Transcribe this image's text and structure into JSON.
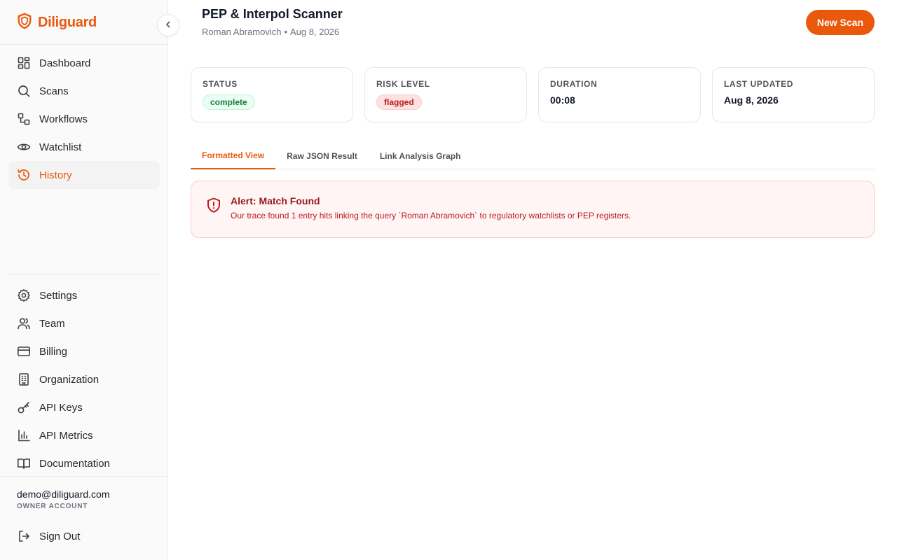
{
  "brand": {
    "name": "Diliguard",
    "accent": "#ea580c"
  },
  "nav": {
    "main": [
      {
        "label": "Dashboard",
        "icon": "dashboard-icon"
      },
      {
        "label": "Scans",
        "icon": "search-icon"
      },
      {
        "label": "Workflows",
        "icon": "workflow-icon"
      },
      {
        "label": "Watchlist",
        "icon": "eye-icon"
      },
      {
        "label": "History",
        "icon": "history-icon",
        "active": true
      }
    ],
    "bottom": [
      {
        "label": "Settings",
        "icon": "gear-icon"
      },
      {
        "label": "Team",
        "icon": "users-icon"
      },
      {
        "label": "Billing",
        "icon": "credit-card-icon"
      },
      {
        "label": "Organization",
        "icon": "building-icon"
      },
      {
        "label": "API Keys",
        "icon": "key-icon"
      },
      {
        "label": "API Metrics",
        "icon": "bar-chart-icon"
      },
      {
        "label": "Documentation",
        "icon": "book-icon"
      }
    ]
  },
  "user": {
    "email": "demo@diliguard.com",
    "role": "OWNER ACCOUNT",
    "signout": "Sign Out"
  },
  "header": {
    "title": "PEP & Interpol Scanner",
    "subject": "Roman Abramovich",
    "separator": "•",
    "date": "Aug 8, 2026",
    "new_scan": "New Scan"
  },
  "cards": {
    "status": {
      "label": "Status",
      "value": "complete",
      "color": "#15803d"
    },
    "risk": {
      "label": "Risk Level",
      "value": "flagged",
      "color": "#b91c1c"
    },
    "duration": {
      "label": "Duration",
      "value": "00:08"
    },
    "updated": {
      "label": "Last Updated",
      "value": "Aug 8, 2026"
    }
  },
  "tabs": [
    {
      "label": "Formatted View",
      "active": true
    },
    {
      "label": "Raw JSON Result"
    },
    {
      "label": "Link Analysis Graph"
    }
  ],
  "alert": {
    "title": "Alert: Match Found",
    "text": "Our trace found 1 entry hits linking the query `Roman Abramovich` to regulatory watchlists or PEP registers."
  }
}
